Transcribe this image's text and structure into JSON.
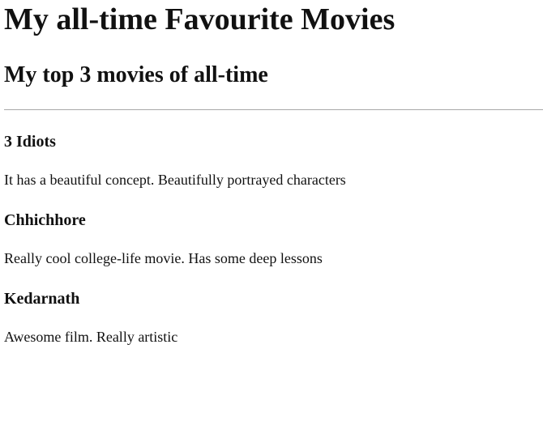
{
  "page": {
    "title": "My all-time Favourite Movies",
    "subtitle": "My top 3 movies of all-time"
  },
  "movies": [
    {
      "title": "3 Idiots",
      "description": "It has a beautiful concept. Beautifully portrayed characters"
    },
    {
      "title": "Chhichhore",
      "description": "Really cool college-life movie. Has some deep lessons"
    },
    {
      "title": "Kedarnath",
      "description": "Awesome film. Really artistic"
    }
  ]
}
